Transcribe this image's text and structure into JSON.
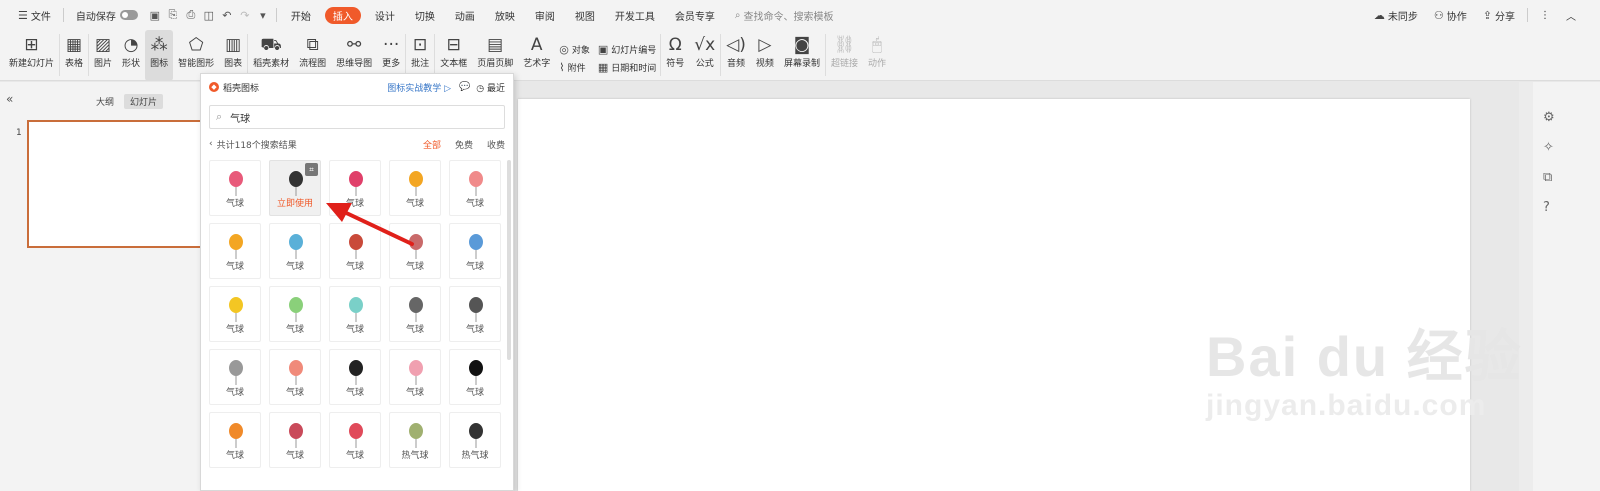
{
  "menubar": {
    "file": "文件",
    "autosave": "自动保存",
    "tabs": [
      "开始",
      "插入",
      "设计",
      "切换",
      "动画",
      "放映",
      "审阅",
      "视图",
      "开发工具",
      "会员专享"
    ],
    "search_placeholder": "查找命令、搜索模板",
    "right": [
      "未同步",
      "协作",
      "分享"
    ]
  },
  "ribbon": {
    "new_slide": "新建幻灯片",
    "table": "表格",
    "picture": "图片",
    "shape": "形状",
    "icon": "图标",
    "smartart": "智能图形",
    "chart": "图表",
    "material": "稻壳素材",
    "flowchart": "流程图",
    "mindmap": "思维导图",
    "more": "更多",
    "comment": "批注",
    "textbox": "文本框",
    "header_footer": "页眉页脚",
    "wordart": "艺术字",
    "object": "对象",
    "attachment": "附件",
    "slide_number": "幻灯片编号",
    "datetime": "日期和时间",
    "symbol": "符号",
    "formula": "公式",
    "audio": "音频",
    "video": "视频",
    "screen_record": "屏幕录制",
    "hyperlink": "超链接",
    "action": "动作"
  },
  "left": {
    "outline": "大纲",
    "slides": "幻灯片",
    "slide_number": "1"
  },
  "panel": {
    "title": "稻壳图标",
    "tutorial": "图标实战教学",
    "recent": "最近",
    "search_value": "气球",
    "result_count": "共计118个搜索结果",
    "filters": [
      "全部",
      "免费",
      "收费"
    ],
    "use_now": "立即使用",
    "labels": [
      "气球",
      "",
      "气球",
      "气球",
      "气球",
      "气球",
      "气球",
      "气球",
      "气球",
      "气球",
      "气球",
      "气球",
      "气球",
      "气球",
      "气球",
      "气球",
      "气球",
      "气球",
      "气球",
      "气球",
      "气球",
      "气球",
      "气球",
      "热气球",
      "热气球"
    ]
  },
  "watermark": {
    "brand": "Bai du 经验",
    "url": "jingyan.baidu.com"
  },
  "colors": {
    "accent": "#f05a2a",
    "link": "#3a78c8",
    "arrow": "#e0201a"
  }
}
